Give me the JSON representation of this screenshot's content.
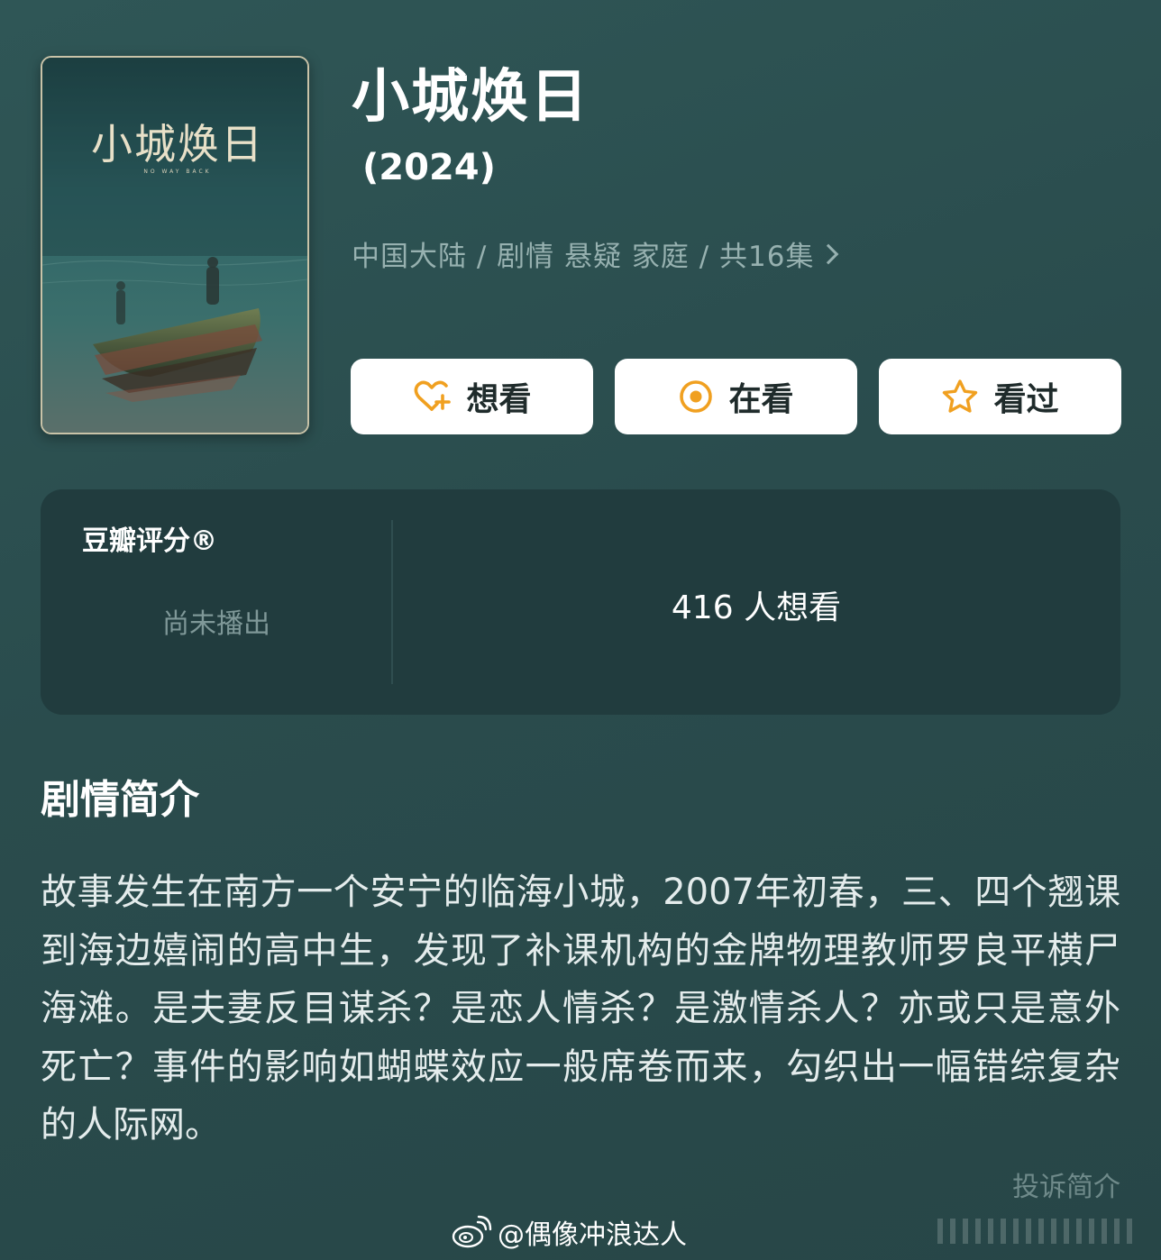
{
  "show": {
    "title": "小城焕日",
    "year": "(2024)",
    "meta": "中国大陆 / 剧情 悬疑 家庭 / 共16集",
    "poster": {
      "title_text": "小城焕日",
      "subtitle_text": "NO WAY BACK"
    }
  },
  "actions": {
    "want_label": "想看",
    "watching_label": "在看",
    "watched_label": "看过"
  },
  "rating": {
    "label": "豆瓣评分®",
    "status": "尚未播出",
    "want_count_text": "416 人想看"
  },
  "synopsis": {
    "heading": "剧情简介",
    "text": "故事发生在南方一个安宁的临海小城，2007年初春，三、四个翘课到海边嬉闹的高中生，发现了补课机构的金牌物理教师罗良平横尸海滩。是夫妻反目谋杀？是恋人情杀？是激情杀人？亦或只是意外死亡？事件的影响如蝴蝶效应一般席卷而来，勾织出一幅错综复杂的人际网。",
    "report_link": "投诉简介"
  },
  "watermark": {
    "text": "@偶像冲浪达人"
  },
  "colors": {
    "background": "#2a4c4d",
    "card": "#213c3e",
    "accent_orange": "#f0a020",
    "muted_text": "#97b1b0"
  },
  "icons": {
    "want": "heart-plus-icon",
    "watching": "target-circle-icon",
    "watched": "star-icon",
    "meta_more": "chevron-right-icon",
    "watermark": "weibo-icon"
  }
}
